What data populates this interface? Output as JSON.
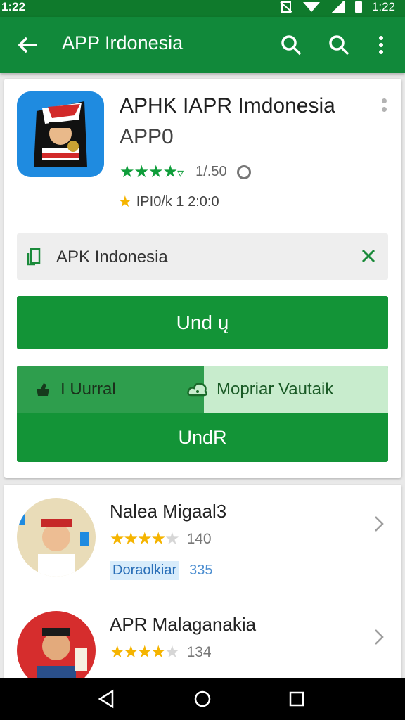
{
  "status_bar": {
    "time_left": "1:22",
    "time_right": "1:22",
    "icons": [
      "no-sim-icon",
      "wifi-icon",
      "signal-icon",
      "battery-icon"
    ]
  },
  "app_bar": {
    "title": "APP Irdonesia",
    "icons": [
      "back-arrow-icon",
      "search-icon",
      "search-icon",
      "more-vert-icon"
    ]
  },
  "app_detail": {
    "name": "APHK IAPR Imdonesia",
    "subtitle": "APP0",
    "rating": "1/.50",
    "meta": "IPI0/k  1 2:0:0",
    "source_label": "APK Indonesia",
    "primary_button": "Und ų",
    "left_option": "I  Uurral",
    "right_option": "Mopriar Vautaik",
    "bottom_button": "UndR"
  },
  "related": [
    {
      "title": "Nalea Migaal3",
      "rating": "140",
      "tag": "Doraolkiar",
      "size": "335",
      "stars_on": 4,
      "stars_total": 5
    },
    {
      "title": "APR Malaganakia",
      "rating": "134",
      "stars_on": 4,
      "stars_total": 5
    }
  ],
  "colors": {
    "primary": "#11893a",
    "button": "#139437",
    "accent_light": "#c8eccd",
    "star": "#f5b400"
  },
  "nav_bar": {
    "icons": [
      "back-triangle-icon",
      "home-circle-icon",
      "recents-square-icon"
    ]
  }
}
